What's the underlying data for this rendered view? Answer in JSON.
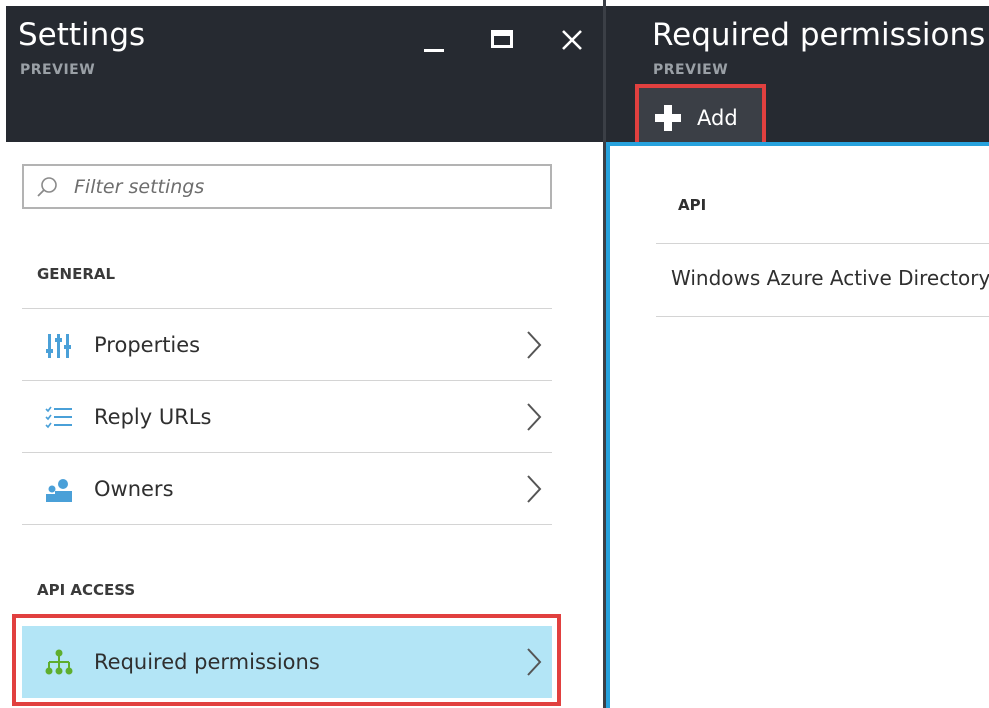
{
  "settings_blade": {
    "title": "Settings",
    "subtitle": "PREVIEW",
    "filter_placeholder": "Filter settings",
    "sections": [
      {
        "label": "GENERAL",
        "items": [
          {
            "label": "Properties",
            "icon": "properties-icon"
          },
          {
            "label": "Reply URLs",
            "icon": "list-icon"
          },
          {
            "label": "Owners",
            "icon": "owners-icon"
          }
        ]
      },
      {
        "label": "API ACCESS",
        "items": [
          {
            "label": "Required permissions",
            "icon": "hierarchy-icon",
            "selected": true
          }
        ]
      }
    ]
  },
  "permissions_blade": {
    "title": "Required permissions",
    "subtitle": "PREVIEW",
    "add_label": "Add",
    "table": {
      "headers": [
        "API"
      ],
      "rows": [
        [
          "Windows Azure Active Directory"
        ]
      ]
    }
  },
  "colors": {
    "header_bg": "#262a31",
    "selected_bg": "#b3e5f6",
    "highlight_border": "#e1403f",
    "accent_blue": "#27a2dd",
    "icon_blue": "#4aa0d8",
    "icon_green": "#5fae2e"
  }
}
